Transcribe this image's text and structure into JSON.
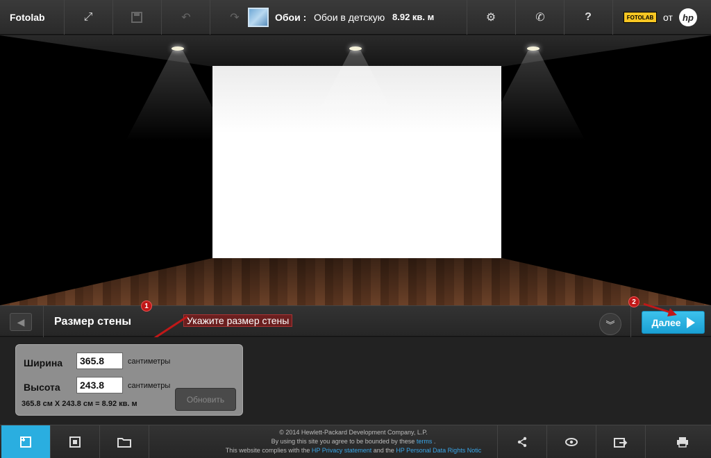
{
  "topbar": {
    "brand": "Fotolab",
    "product_label": "Обои :",
    "product_name": "Обои в детскую",
    "product_area": "8.92 кв. м",
    "badge_text": "FOTOLAB",
    "by_label": "от",
    "hp_logo": "hp",
    "icons": [
      "expand-icon",
      "save-icon",
      "undo-icon",
      "redo-icon",
      "gear-icon",
      "phone-icon",
      "help-icon"
    ]
  },
  "stepbar": {
    "title": "Размер стены",
    "hint": "Укажите размер стены",
    "marker1": "1",
    "marker2": "2",
    "next_label": "Далее"
  },
  "size_panel": {
    "width_label": "Ширина",
    "width_value": "365.8",
    "width_unit": "сантиметры",
    "height_label": "Высота",
    "height_value": "243.8",
    "height_unit": "сантиметры",
    "summary": "365.8 см X 243.8 см = 8.92 кв. м",
    "update_label": "Обновить"
  },
  "footer": {
    "line1": "© 2014 Hewlett-Packard Development Company, L.P.",
    "line2_text": "By using this site you agree to be bounded by these",
    "line2_link": "terms",
    "line2_end": ".",
    "line3_text": "This website complies with the",
    "line3_link1": "HP Privacy statement",
    "line3_mid": "and the",
    "line3_link2": "HP Personal Data Rights Notic"
  },
  "colors": {
    "accent": "#2aaee0",
    "marker": "#c01818"
  }
}
